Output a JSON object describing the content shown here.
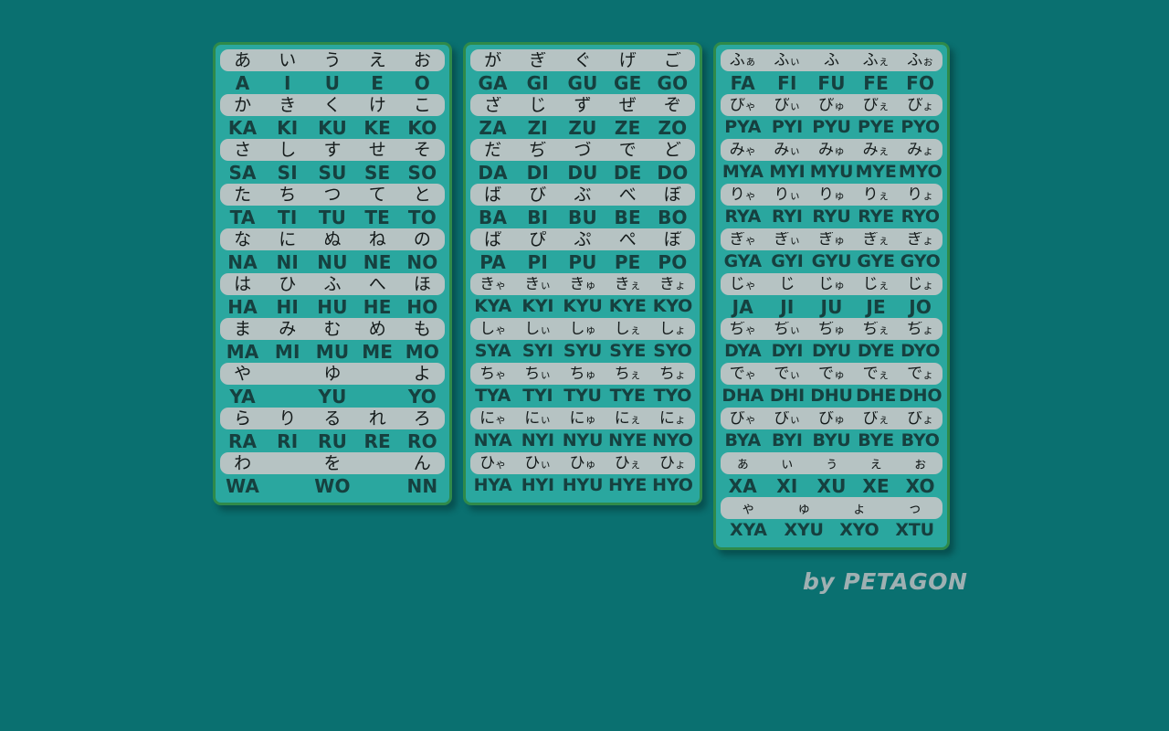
{
  "background_color": "#0a7070",
  "card_color": "#2aa79f",
  "card_border_color": "#2f8a4a",
  "pill_color": "#b6c3c3",
  "kana_text_color": "#141a1a",
  "romaji_text_color": "#16403f",
  "signature": {
    "text": "by PETAGON",
    "color": "#9fb0b2"
  },
  "columns": [
    {
      "id": "basic-hiragana",
      "rows": [
        {
          "kana": [
            "あ",
            "い",
            "う",
            "え",
            "お"
          ],
          "romaji": [
            "A",
            "I",
            "U",
            "E",
            "O"
          ]
        },
        {
          "kana": [
            "か",
            "き",
            "く",
            "け",
            "こ"
          ],
          "romaji": [
            "KA",
            "KI",
            "KU",
            "KE",
            "KO"
          ]
        },
        {
          "kana": [
            "さ",
            "し",
            "す",
            "せ",
            "そ"
          ],
          "romaji": [
            "SA",
            "SI",
            "SU",
            "SE",
            "SO"
          ]
        },
        {
          "kana": [
            "た",
            "ち",
            "つ",
            "て",
            "と"
          ],
          "romaji": [
            "TA",
            "TI",
            "TU",
            "TE",
            "TO"
          ]
        },
        {
          "kana": [
            "な",
            "に",
            "ぬ",
            "ね",
            "の"
          ],
          "romaji": [
            "NA",
            "NI",
            "NU",
            "NE",
            "NO"
          ]
        },
        {
          "kana": [
            "は",
            "ひ",
            "ふ",
            "へ",
            "ほ"
          ],
          "romaji": [
            "HA",
            "HI",
            "HU",
            "HE",
            "HO"
          ]
        },
        {
          "kana": [
            "ま",
            "み",
            "む",
            "め",
            "も"
          ],
          "romaji": [
            "MA",
            "MI",
            "MU",
            "ME",
            "MO"
          ]
        },
        {
          "kana": [
            "や",
            "",
            "ゆ",
            "",
            "よ"
          ],
          "romaji": [
            "YA",
            "",
            "YU",
            "",
            "YO"
          ]
        },
        {
          "kana": [
            "ら",
            "り",
            "る",
            "れ",
            "ろ"
          ],
          "romaji": [
            "RA",
            "RI",
            "RU",
            "RE",
            "RO"
          ]
        },
        {
          "kana": [
            "わ",
            "",
            "を",
            "",
            "ん"
          ],
          "romaji": [
            "WA",
            "",
            "WO",
            "",
            "NN"
          ]
        }
      ]
    },
    {
      "id": "dakuten-and-digraphs",
      "rows": [
        {
          "kana": [
            "が",
            "ぎ",
            "ぐ",
            "げ",
            "ご"
          ],
          "romaji": [
            "GA",
            "GI",
            "GU",
            "GE",
            "GO"
          ]
        },
        {
          "kana": [
            "ざ",
            "じ",
            "ず",
            "ぜ",
            "ぞ"
          ],
          "romaji": [
            "ZA",
            "ZI",
            "ZU",
            "ZE",
            "ZO"
          ]
        },
        {
          "kana": [
            "だ",
            "ぢ",
            "づ",
            "で",
            "ど"
          ],
          "romaji": [
            "DA",
            "DI",
            "DU",
            "DE",
            "DO"
          ]
        },
        {
          "kana": [
            "ば",
            "び",
            "ぶ",
            "べ",
            "ぼ"
          ],
          "romaji": [
            "BA",
            "BI",
            "BU",
            "BE",
            "BO"
          ]
        },
        {
          "kana": [
            "ぱ",
            "ぴ",
            "ぷ",
            "ぺ",
            "ぽ"
          ],
          "romaji": [
            "PA",
            "PI",
            "PU",
            "PE",
            "PO"
          ]
        },
        {
          "kana": [
            "きゃ",
            "きぃ",
            "きゅ",
            "きぇ",
            "きょ"
          ],
          "romaji": [
            "KYA",
            "KYI",
            "KYU",
            "KYE",
            "KYO"
          ],
          "style": "compact tri"
        },
        {
          "kana": [
            "しゃ",
            "しぃ",
            "しゅ",
            "しぇ",
            "しょ"
          ],
          "romaji": [
            "SYA",
            "SYI",
            "SYU",
            "SYE",
            "SYO"
          ],
          "style": "compact tri"
        },
        {
          "kana": [
            "ちゃ",
            "ちぃ",
            "ちゅ",
            "ちぇ",
            "ちょ"
          ],
          "romaji": [
            "TYA",
            "TYI",
            "TYU",
            "TYE",
            "TYO"
          ],
          "style": "compact tri"
        },
        {
          "kana": [
            "にゃ",
            "にぃ",
            "にゅ",
            "にぇ",
            "にょ"
          ],
          "romaji": [
            "NYA",
            "NYI",
            "NYU",
            "NYE",
            "NYO"
          ],
          "style": "compact tri"
        },
        {
          "kana": [
            "ひゃ",
            "ひぃ",
            "ひゅ",
            "ひぇ",
            "ひょ"
          ],
          "romaji": [
            "HYA",
            "HYI",
            "HYU",
            "HYE",
            "HYO"
          ],
          "style": "compact tri"
        }
      ]
    },
    {
      "id": "extended-digraphs",
      "rows": [
        {
          "kana": [
            "ふぁ",
            "ふぃ",
            "ふ",
            "ふぇ",
            "ふぉ"
          ],
          "romaji": [
            "FA",
            "FI",
            "FU",
            "FE",
            "FO"
          ],
          "style": "compact"
        },
        {
          "kana": [
            "ぴゃ",
            "ぴぃ",
            "ぴゅ",
            "ぴぇ",
            "ぴょ"
          ],
          "romaji": [
            "PYA",
            "PYI",
            "PYU",
            "PYE",
            "PYO"
          ],
          "style": "compact tri"
        },
        {
          "kana": [
            "みゃ",
            "みぃ",
            "みゅ",
            "みぇ",
            "みょ"
          ],
          "romaji": [
            "MYA",
            "MYI",
            "MYU",
            "MYE",
            "MYO"
          ],
          "style": "compact tri"
        },
        {
          "kana": [
            "りゃ",
            "りぃ",
            "りゅ",
            "りぇ",
            "りょ"
          ],
          "romaji": [
            "RYA",
            "RYI",
            "RYU",
            "RYE",
            "RYO"
          ],
          "style": "compact tri"
        },
        {
          "kana": [
            "ぎゃ",
            "ぎぃ",
            "ぎゅ",
            "ぎぇ",
            "ぎょ"
          ],
          "romaji": [
            "GYA",
            "GYI",
            "GYU",
            "GYE",
            "GYO"
          ],
          "style": "compact tri"
        },
        {
          "kana": [
            "じゃ",
            "じ",
            "じゅ",
            "じぇ",
            "じょ"
          ],
          "romaji": [
            "JA",
            "JI",
            "JU",
            "JE",
            "JO"
          ],
          "style": "compact"
        },
        {
          "kana": [
            "ぢゃ",
            "ぢぃ",
            "ぢゅ",
            "ぢぇ",
            "ぢょ"
          ],
          "romaji": [
            "DYA",
            "DYI",
            "DYU",
            "DYE",
            "DYO"
          ],
          "style": "compact tri"
        },
        {
          "kana": [
            "でゃ",
            "でぃ",
            "でゅ",
            "でぇ",
            "でょ"
          ],
          "romaji": [
            "DHA",
            "DHI",
            "DHU",
            "DHE",
            "DHO"
          ],
          "style": "compact tri"
        },
        {
          "kana": [
            "びゃ",
            "びぃ",
            "びゅ",
            "びぇ",
            "びょ"
          ],
          "romaji": [
            "BYA",
            "BYI",
            "BYU",
            "BYE",
            "BYO"
          ],
          "style": "compact tri"
        },
        {
          "kana": [
            "ぁ",
            "ぃ",
            "ぅ",
            "ぇ",
            "ぉ"
          ],
          "romaji": [
            "XA",
            "XI",
            "XU",
            "XE",
            "XO"
          ],
          "style": "smallkana"
        },
        {
          "kana": [
            "ゃ",
            "ゅ",
            "ょ",
            "っ"
          ],
          "romaji": [
            "XYA",
            "XYU",
            "XYO",
            "XTU"
          ],
          "style": "smallkana cols-4 tri"
        }
      ]
    }
  ]
}
